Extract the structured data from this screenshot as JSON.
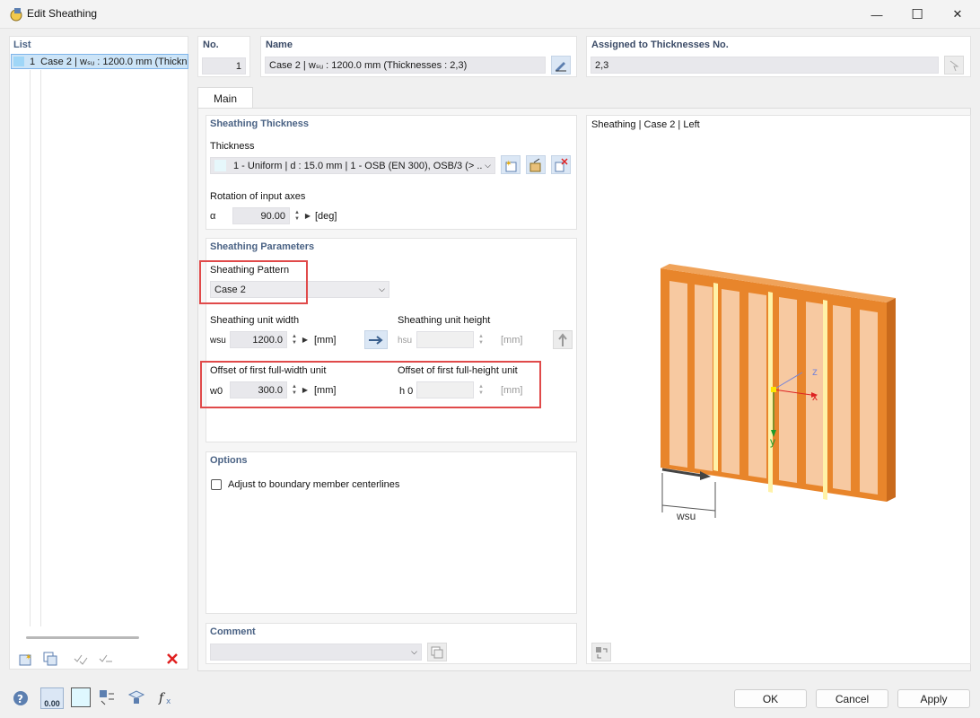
{
  "window": {
    "title": "Edit Sheathing",
    "minimize_glyph": "—",
    "maximize_glyph": "☐",
    "close_glyph": "✕"
  },
  "list": {
    "header": "List",
    "items": [
      {
        "number": "1",
        "label": "Case 2 | wₛᵤ : 1200.0 mm (Thickn"
      }
    ]
  },
  "header": {
    "no_label": "No.",
    "no_value": "1",
    "name_label": "Name",
    "name_value": "Case 2 | wₛᵤ : 1200.0 mm (Thicknesses : 2,3)",
    "assigned_label": "Assigned to Thicknesses No.",
    "assigned_value": "2,3"
  },
  "tabs": [
    {
      "label": "Main",
      "active": true
    }
  ],
  "thickness_section": {
    "title": "Sheathing Thickness",
    "thickness_label": "Thickness",
    "thickness_value": "1 - Uniform | d : 15.0 mm | 1 - OSB (EN 300), OSB/3 (> ...",
    "rotation_label": "Rotation of input axes",
    "alpha_symbol": "α",
    "alpha_value": "90.00",
    "alpha_unit": "[deg]"
  },
  "parameters_section": {
    "title": "Sheathing Parameters",
    "pattern_label": "Sheathing Pattern",
    "pattern_value": "Case 2",
    "width_label": "Sheathing unit width",
    "width_symbol": "wsu",
    "width_value": "1200.0",
    "width_unit": "[mm]",
    "height_label": "Sheathing unit height",
    "height_symbol": "hsu",
    "height_value": "",
    "height_unit": "[mm]",
    "offset_w_label": "Offset of first full-width unit",
    "offset_w_symbol": "w0",
    "offset_w_value": "300.0",
    "offset_w_unit": "[mm]",
    "offset_h_label": "Offset of first full-height unit",
    "offset_h_symbol": "h 0",
    "offset_h_value": "",
    "offset_h_unit": "[mm]"
  },
  "options_section": {
    "title": "Options",
    "adjust_label": "Adjust to boundary member centerlines",
    "adjust_checked": false
  },
  "comment_section": {
    "title": "Comment",
    "value": ""
  },
  "preview": {
    "title": "Sheathing | Case 2 | Left",
    "axis_x": "x",
    "axis_y": "y",
    "axis_z": "z",
    "dim_label": "wsu",
    "colors": {
      "frame": "#e8852b",
      "panel": "#f7c9a1",
      "joint": "#fff2a8"
    }
  },
  "footer": {
    "ok_label": "OK",
    "cancel_label": "Cancel",
    "apply_label": "Apply",
    "units_icon_text": "0.00"
  }
}
